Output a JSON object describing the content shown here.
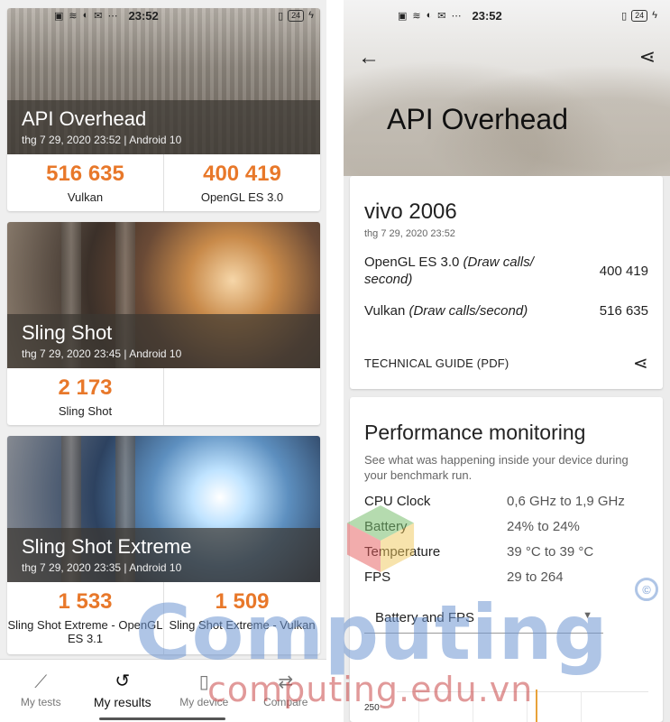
{
  "status": {
    "time": "23:52",
    "battery": "24"
  },
  "left": {
    "cards": [
      {
        "title": "API Overhead",
        "date": "thg 7 29, 2020 23:52 | Android 10",
        "scores": [
          {
            "value": "516 635",
            "label": "Vulkan"
          },
          {
            "value": "400 419",
            "label": "OpenGL ES 3.0"
          }
        ]
      },
      {
        "title": "Sling Shot",
        "date": "thg 7 29, 2020 23:45 | Android 10",
        "scores": [
          {
            "value": "2 173",
            "label": "Sling Shot"
          }
        ]
      },
      {
        "title": "Sling Shot Extreme",
        "date": "thg 7 29, 2020 23:35 | Android 10",
        "scores": [
          {
            "value": "1 533",
            "label": "Sling Shot Extreme - OpenGL ES 3.1"
          },
          {
            "value": "1 509",
            "label": "Sling Shot Extreme - Vulkan"
          }
        ]
      }
    ],
    "nav": [
      {
        "label": "My tests",
        "icon": "feather-icon"
      },
      {
        "label": "My results",
        "icon": "history-icon"
      },
      {
        "label": "My device",
        "icon": "phone-icon"
      },
      {
        "label": "Compare",
        "icon": "compare-icon"
      }
    ]
  },
  "right": {
    "title": "API Overhead",
    "device": {
      "name": "vivo 2006",
      "date": "thg 7 29, 2020 23:52",
      "metrics": [
        {
          "name": "OpenGL ES 3.0",
          "unit": "(Draw calls/ second)",
          "value": "400 419"
        },
        {
          "name": "Vulkan",
          "unit": "(Draw calls/second)",
          "value": "516 635"
        }
      ],
      "tech_guide": "TECHNICAL GUIDE (PDF)"
    },
    "perf": {
      "title": "Performance monitoring",
      "desc": "See what was happening inside your device during your benchmark run.",
      "rows": [
        {
          "k": "CPU Clock",
          "v": "0,6 GHz to 1,9 GHz"
        },
        {
          "k": "Battery",
          "v": "24% to 24%"
        },
        {
          "k": "Temperature",
          "v": "39 °C to 39 °C"
        },
        {
          "k": "FPS",
          "v": "29 to 264"
        }
      ],
      "select": "Battery and FPS",
      "axis_label": "250"
    }
  },
  "watermark": {
    "main": "Computing",
    "sub": "computing.edu.vn"
  },
  "colors": {
    "score": "#e8782a",
    "overlay": "#3c3732"
  }
}
